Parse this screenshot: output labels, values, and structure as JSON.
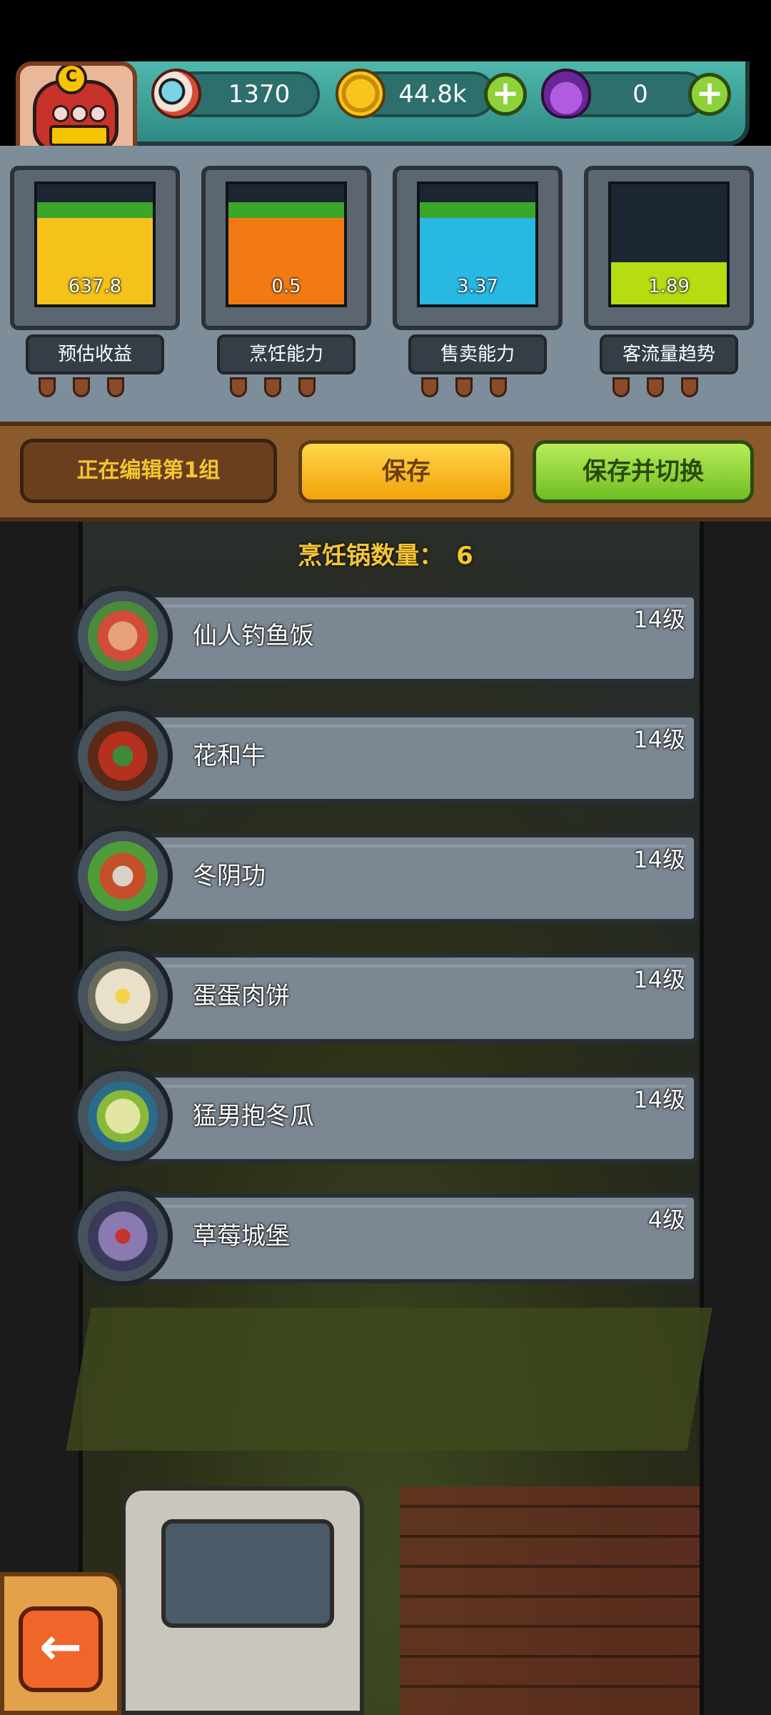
{
  "resources": {
    "eyeballs": "1370",
    "coins": "44.8k",
    "potion": "0"
  },
  "meters": [
    {
      "value": "637.8",
      "label": "预估收益",
      "fill_fraction": 0.85,
      "color": "#f4c21a"
    },
    {
      "value": "0.5",
      "label": "烹饪能力",
      "fill_fraction": 0.85,
      "color": "#f27a12"
    },
    {
      "value": "3.37",
      "label": "售卖能力",
      "fill_fraction": 0.85,
      "color": "#27b8e4"
    },
    {
      "value": "1.89",
      "label": "客流量趋势",
      "fill_fraction": 0.35,
      "color": "#b7dd12"
    }
  ],
  "editbar": {
    "group_label": "正在编辑第1组",
    "save_label": "保存",
    "save_switch_label": "保存并切换"
  },
  "pot_count": {
    "label": "烹饪锅数量：",
    "value": "6"
  },
  "recipes": [
    {
      "name": "仙人钓鱼饭",
      "level": "14级"
    },
    {
      "name": "花和牛",
      "level": "14级"
    },
    {
      "name": "冬阴功",
      "level": "14级"
    },
    {
      "name": "蛋蛋肉饼",
      "level": "14级"
    },
    {
      "name": "猛男抱冬瓜",
      "level": "14级"
    },
    {
      "name": "草莓城堡",
      "level": "4级"
    }
  ],
  "icons": {
    "eyeball": "eyeball-icon",
    "coin": "coin-icon",
    "potion": "potion-icon",
    "plus": "plus-icon",
    "back": "back-arrow-icon"
  }
}
